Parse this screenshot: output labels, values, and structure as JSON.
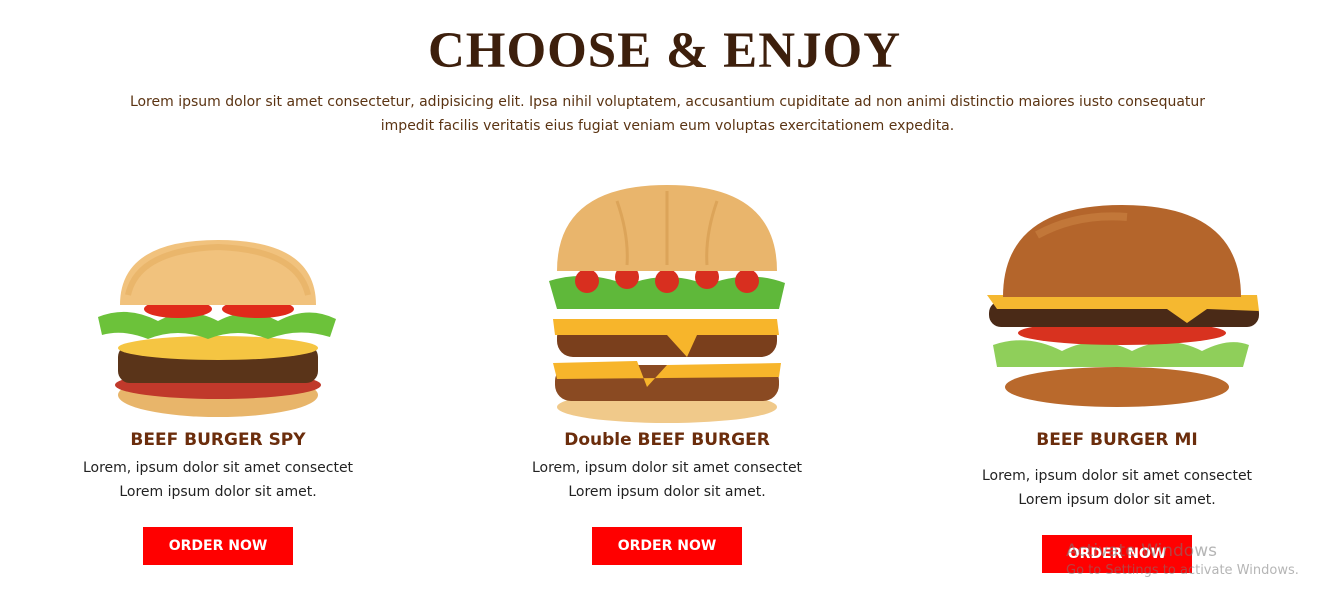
{
  "section": {
    "title": "CHOOSE & ENJOY",
    "intro": "Lorem ipsum dolor sit amet consectetur, adipisicing elit. Ipsa nihil voluptatem, accusantium cupiditate ad non animi distinctio maiores iusto consequatur impedit facilis veritatis eius fugiat veniam eum voluptas exercitationem expedita."
  },
  "cards": [
    {
      "title": "BEEF BURGER SPY",
      "desc_line1": "Lorem, ipsum dolor sit amet consectet",
      "desc_line2": "Lorem ipsum dolor sit amet.",
      "button": "ORDER NOW"
    },
    {
      "title": "Double BEEF BURGER",
      "desc_line1": "Lorem, ipsum dolor sit amet consectet",
      "desc_line2": "Lorem ipsum dolor sit amet.",
      "button": "ORDER NOW"
    },
    {
      "title": "BEEF BURGER MI",
      "desc_line1": "Lorem, ipsum dolor sit amet consectet",
      "desc_line2": "Lorem ipsum dolor sit amet.",
      "button": "ORDER NOW"
    }
  ],
  "watermark": {
    "title": "Activate Windows",
    "subtitle": "Go to Settings to activate Windows."
  },
  "colors": {
    "heading": "#3d1f0c",
    "card_title": "#6b2d0c",
    "button": "#ff0000"
  }
}
